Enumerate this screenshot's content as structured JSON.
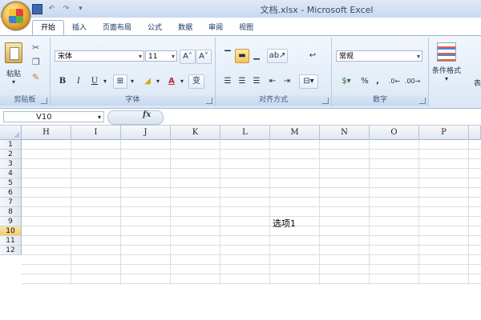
{
  "window": {
    "title": "文档.xlsx - Microsoft Excel"
  },
  "quick_access": {
    "undo_glyph": "↶",
    "redo_glyph": "↷",
    "customize_glyph": "▾"
  },
  "tabs": [
    {
      "label": "开始",
      "active": true
    },
    {
      "label": "插入"
    },
    {
      "label": "页面布局"
    },
    {
      "label": "公式"
    },
    {
      "label": "数据"
    },
    {
      "label": "审阅"
    },
    {
      "label": "视图"
    }
  ],
  "ribbon": {
    "clipboard": {
      "label": "剪贴板",
      "paste_label": "粘贴"
    },
    "font": {
      "label": "字体",
      "font_name": "宋体",
      "font_size": "11",
      "grow_label": "A˄",
      "shrink_label": "A˅",
      "bold": "B",
      "italic": "I",
      "underline": "U",
      "font_color_label": "A",
      "phonetic_label": "变"
    },
    "alignment": {
      "label": "对齐方式"
    },
    "number": {
      "label": "数字",
      "format": "常规",
      "percent": "%",
      "comma": ","
    },
    "styles": {
      "conditional_label": "条件格式",
      "table_label": "表"
    }
  },
  "formula_bar": {
    "name_box": "V10",
    "fx": "fx",
    "value": ""
  },
  "sheet": {
    "columns": [
      "H",
      "I",
      "J",
      "K",
      "L",
      "M",
      "N",
      "O",
      "P"
    ],
    "rows": [
      "1",
      "2",
      "3",
      "4",
      "5",
      "6",
      "7",
      "8",
      "9",
      "10",
      "11",
      "12"
    ],
    "active_row": "10",
    "cell_text": "选项1"
  },
  "colors": {
    "ribbon_bg": "#dbe7f5",
    "active_row_header": "#f5c86a",
    "grid_line": "#d9dee6"
  }
}
